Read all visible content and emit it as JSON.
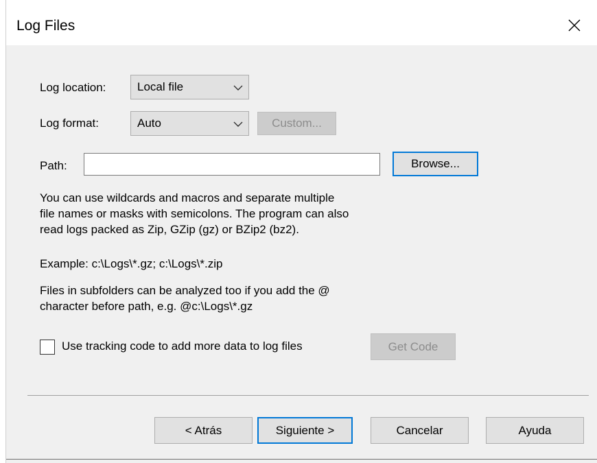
{
  "window": {
    "title": "Log Files",
    "close_icon": "close-icon"
  },
  "log_location": {
    "label": "Log location:",
    "selected": "Local file"
  },
  "log_format": {
    "label": "Log format:",
    "selected": "Auto",
    "custom_button": "Custom..."
  },
  "path": {
    "label": "Path:",
    "value": "",
    "browse_button": "Browse..."
  },
  "help": {
    "paragraph1": "You can use wildcards and macros and separate multiple\nfile names or masks with semicolons. The program can also\nread logs packed as Zip, GZip (gz) or BZip2 (bz2).",
    "example": "Example: c:\\Logs\\*.gz; c:\\Logs\\*.zip",
    "paragraph2": "Files in subfolders can be analyzed too if you add the @\ncharacter before path, e.g. @c:\\Logs\\*.gz"
  },
  "tracking": {
    "checkbox_label": "Use tracking code to add more data to log files",
    "checked": false,
    "get_code_button": "Get Code"
  },
  "footer": {
    "back_button": "< Atrás",
    "next_button": "Siguiente >",
    "cancel_button": "Cancelar",
    "help_button": "Ayuda"
  },
  "colors": {
    "dialog_bg": "#f0f0f0",
    "titlebar_bg": "#ffffff",
    "focus_border": "#0078d7",
    "button_bg": "#e1e1e1",
    "disabled_text": "#8c8c8c"
  }
}
